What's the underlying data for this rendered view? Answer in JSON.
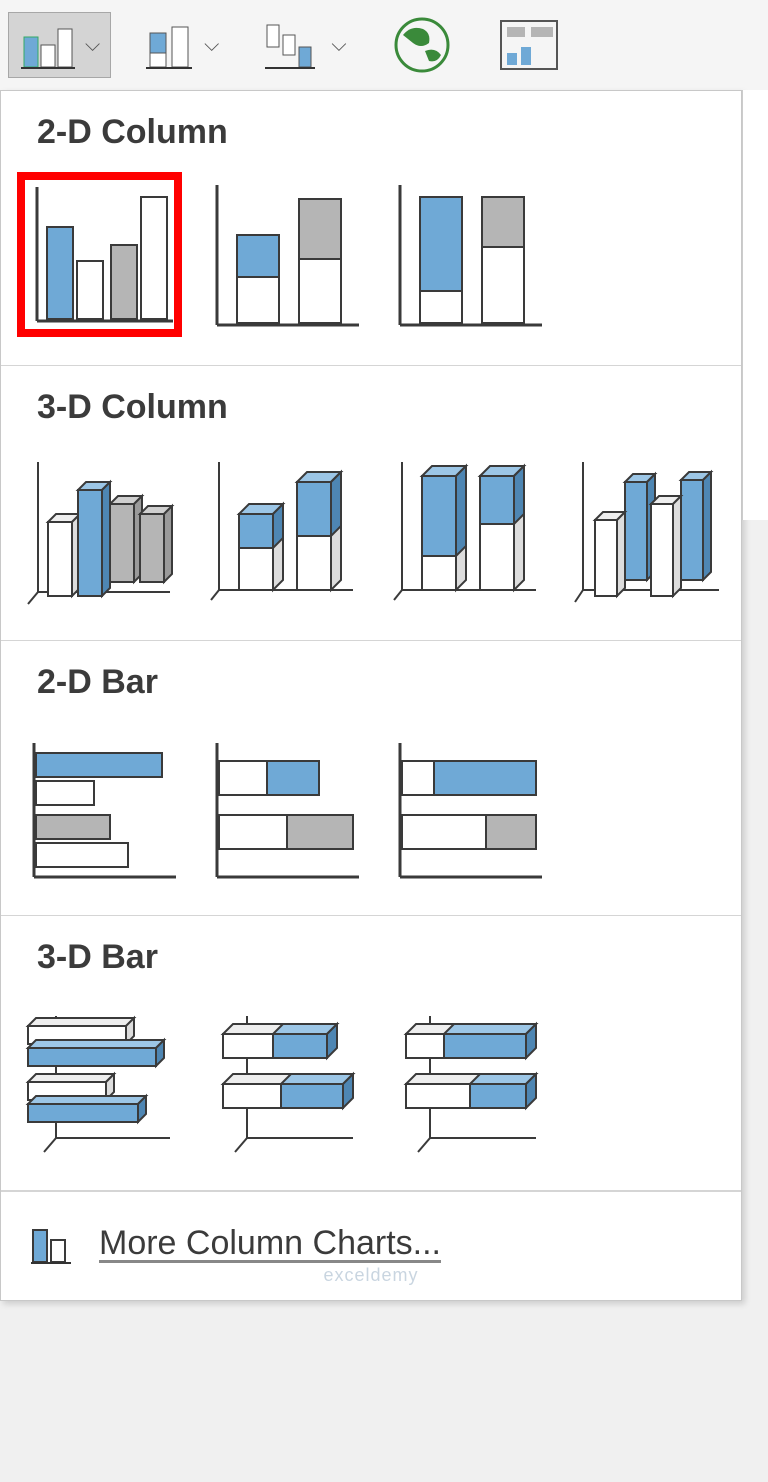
{
  "sections": {
    "col2d": "2-D Column",
    "col3d": "3-D Column",
    "bar2d": "2-D Bar",
    "bar3d": "3-D Bar"
  },
  "footer": {
    "more": "More Column Charts..."
  },
  "watermark": "exceldemy",
  "colors": {
    "blue": "#6fa9d6",
    "gray": "#b5b5b5",
    "line": "#3a3a3a"
  }
}
